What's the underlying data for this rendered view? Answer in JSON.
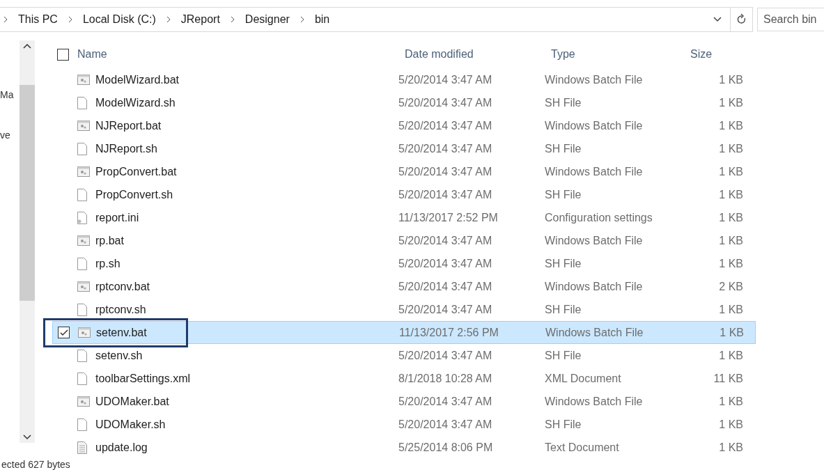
{
  "breadcrumb": [
    "This PC",
    "Local Disk (C:)",
    "JReport",
    "Designer",
    "bin"
  ],
  "search": {
    "placeholder": "Search bin"
  },
  "nav": {
    "items": [
      "Ma",
      "ve"
    ]
  },
  "table": {
    "columns": [
      "Name",
      "Date modified",
      "Type",
      "Size"
    ],
    "header_checked": false,
    "rows": [
      {
        "name": "ModelWizard.bat",
        "date": "5/20/2014 3:47 AM",
        "type": "Windows Batch File",
        "size": "1 KB",
        "kind": "bat",
        "selected": false
      },
      {
        "name": "ModelWizard.sh",
        "date": "5/20/2014 3:47 AM",
        "type": "SH File",
        "size": "1 KB",
        "kind": "sh",
        "selected": false
      },
      {
        "name": "NJReport.bat",
        "date": "5/20/2014 3:47 AM",
        "type": "Windows Batch File",
        "size": "1 KB",
        "kind": "bat",
        "selected": false
      },
      {
        "name": "NJReport.sh",
        "date": "5/20/2014 3:47 AM",
        "type": "SH File",
        "size": "1 KB",
        "kind": "sh",
        "selected": false
      },
      {
        "name": "PropConvert.bat",
        "date": "5/20/2014 3:47 AM",
        "type": "Windows Batch File",
        "size": "1 KB",
        "kind": "bat",
        "selected": false
      },
      {
        "name": "PropConvert.sh",
        "date": "5/20/2014 3:47 AM",
        "type": "SH File",
        "size": "1 KB",
        "kind": "sh",
        "selected": false
      },
      {
        "name": "report.ini",
        "date": "11/13/2017 2:52 PM",
        "type": "Configuration settings",
        "size": "1 KB",
        "kind": "ini",
        "selected": false
      },
      {
        "name": "rp.bat",
        "date": "5/20/2014 3:47 AM",
        "type": "Windows Batch File",
        "size": "1 KB",
        "kind": "bat",
        "selected": false
      },
      {
        "name": "rp.sh",
        "date": "5/20/2014 3:47 AM",
        "type": "SH File",
        "size": "1 KB",
        "kind": "sh",
        "selected": false
      },
      {
        "name": "rptconv.bat",
        "date": "5/20/2014 3:47 AM",
        "type": "Windows Batch File",
        "size": "2 KB",
        "kind": "bat",
        "selected": false
      },
      {
        "name": "rptconv.sh",
        "date": "5/20/2014 3:47 AM",
        "type": "SH File",
        "size": "1 KB",
        "kind": "sh",
        "selected": false
      },
      {
        "name": "setenv.bat",
        "date": "11/13/2017 2:56 PM",
        "type": "Windows Batch File",
        "size": "1 KB",
        "kind": "bat",
        "selected": true
      },
      {
        "name": "setenv.sh",
        "date": "5/20/2014 3:47 AM",
        "type": "SH File",
        "size": "1 KB",
        "kind": "sh",
        "selected": false
      },
      {
        "name": "toolbarSettings.xml",
        "date": "8/1/2018 10:28 AM",
        "type": "XML Document",
        "size": "11 KB",
        "kind": "sh",
        "selected": false
      },
      {
        "name": "UDOMaker.bat",
        "date": "5/20/2014 3:47 AM",
        "type": "Windows Batch File",
        "size": "1 KB",
        "kind": "bat",
        "selected": false
      },
      {
        "name": "UDOMaker.sh",
        "date": "5/20/2014 3:47 AM",
        "type": "SH File",
        "size": "1 KB",
        "kind": "sh",
        "selected": false
      },
      {
        "name": "update.log",
        "date": "5/25/2014 8:06 PM",
        "type": "Text Document",
        "size": "1 KB",
        "kind": "log",
        "selected": false
      }
    ]
  },
  "status_bar": {
    "text": "ected  627 bytes"
  }
}
